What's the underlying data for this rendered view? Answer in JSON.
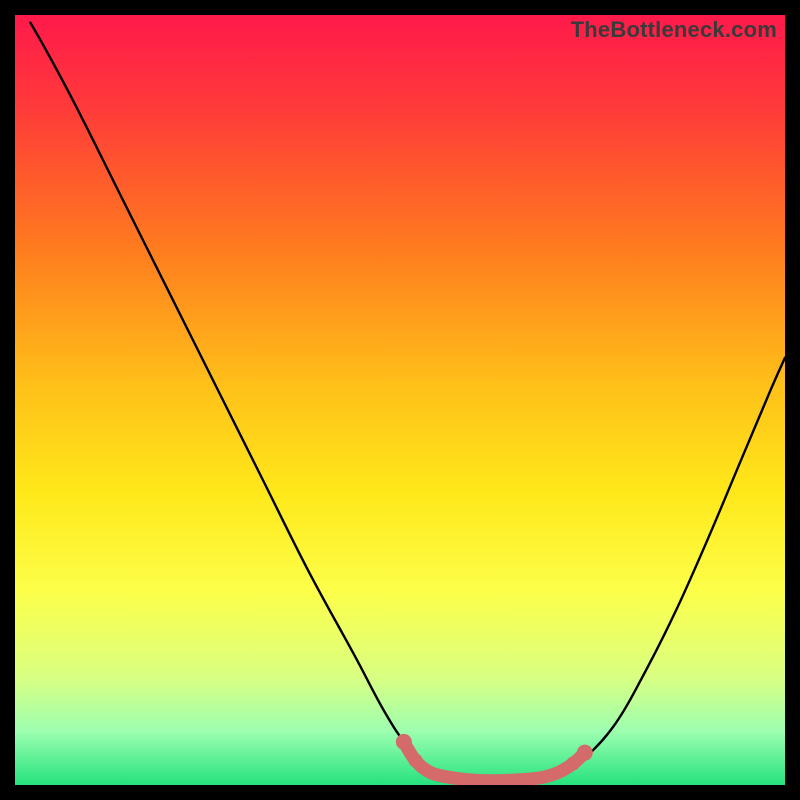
{
  "watermark": "TheBottleneck.com",
  "chart_data": {
    "type": "line",
    "title": "",
    "xlabel": "",
    "ylabel": "",
    "xlim": [
      0,
      100
    ],
    "ylim": [
      0,
      100
    ],
    "grid": false,
    "legend": false,
    "gradient_stops": [
      {
        "offset": 0.0,
        "color": "#ff1a4b"
      },
      {
        "offset": 0.12,
        "color": "#ff3a3a"
      },
      {
        "offset": 0.3,
        "color": "#ff7a1f"
      },
      {
        "offset": 0.48,
        "color": "#ffc019"
      },
      {
        "offset": 0.62,
        "color": "#ffe81a"
      },
      {
        "offset": 0.75,
        "color": "#fcff4a"
      },
      {
        "offset": 0.86,
        "color": "#d9ff82"
      },
      {
        "offset": 0.93,
        "color": "#9dffb0"
      },
      {
        "offset": 1.0,
        "color": "#25e27e"
      }
    ],
    "series": [
      {
        "name": "bottleneck-curve",
        "color": "#000000",
        "points": [
          {
            "x": 2.0,
            "y": 99.0
          },
          {
            "x": 4.0,
            "y": 95.5
          },
          {
            "x": 8.0,
            "y": 88.0
          },
          {
            "x": 14.0,
            "y": 76.0
          },
          {
            "x": 20.0,
            "y": 64.0
          },
          {
            "x": 26.0,
            "y": 52.0
          },
          {
            "x": 32.0,
            "y": 40.0
          },
          {
            "x": 38.0,
            "y": 28.0
          },
          {
            "x": 44.0,
            "y": 17.0
          },
          {
            "x": 48.0,
            "y": 9.5
          },
          {
            "x": 51.0,
            "y": 5.0
          },
          {
            "x": 54.0,
            "y": 2.2
          },
          {
            "x": 57.0,
            "y": 0.9
          },
          {
            "x": 60.0,
            "y": 0.5
          },
          {
            "x": 64.0,
            "y": 0.5
          },
          {
            "x": 68.0,
            "y": 0.8
          },
          {
            "x": 71.0,
            "y": 1.6
          },
          {
            "x": 74.0,
            "y": 3.5
          },
          {
            "x": 78.0,
            "y": 8.0
          },
          {
            "x": 82.0,
            "y": 15.0
          },
          {
            "x": 86.0,
            "y": 23.0
          },
          {
            "x": 90.0,
            "y": 32.0
          },
          {
            "x": 94.0,
            "y": 41.5
          },
          {
            "x": 98.0,
            "y": 51.0
          },
          {
            "x": 100.0,
            "y": 55.5
          }
        ]
      },
      {
        "name": "bottleneck-marker-band",
        "color": "#d46a6a",
        "style": "thick-dotted",
        "points": [
          {
            "x": 50.5,
            "y": 5.6
          },
          {
            "x": 52.0,
            "y": 3.2
          },
          {
            "x": 54.0,
            "y": 1.6
          },
          {
            "x": 57.0,
            "y": 0.9
          },
          {
            "x": 60.0,
            "y": 0.6
          },
          {
            "x": 64.0,
            "y": 0.6
          },
          {
            "x": 68.0,
            "y": 0.9
          },
          {
            "x": 70.5,
            "y": 1.6
          },
          {
            "x": 72.5,
            "y": 2.8
          },
          {
            "x": 74.0,
            "y": 4.2
          }
        ]
      }
    ]
  }
}
